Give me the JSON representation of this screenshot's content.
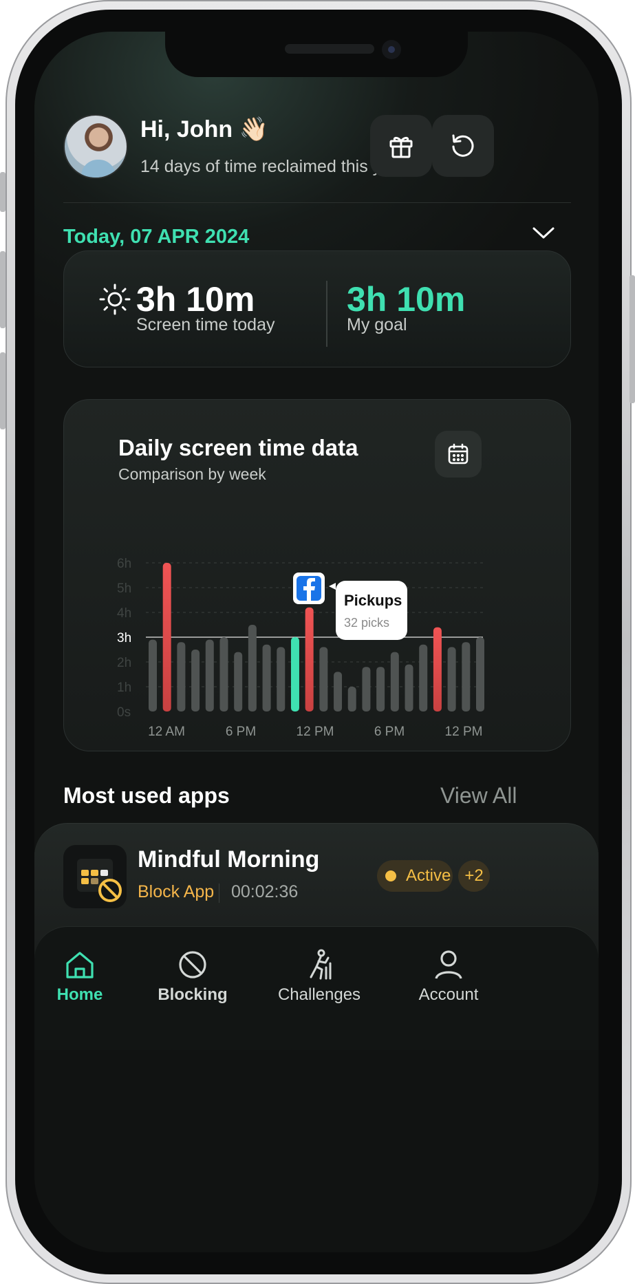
{
  "header": {
    "greeting": "Hi, John 👋🏻",
    "subtitle": "14 days of time reclaimed this year!"
  },
  "date_label": "Today, 07 APR 2024",
  "stats": {
    "screen_time_value": "3h 10m",
    "screen_time_label": "Screen time today",
    "goal_value": "3h 10m",
    "goal_label": "My goal"
  },
  "chart_card": {
    "title": "Daily screen time data",
    "subtitle": "Comparison by week"
  },
  "chart_data": {
    "type": "bar",
    "y_ticks": [
      "0s",
      "1h",
      "2h",
      "3h",
      "4h",
      "5h",
      "6h"
    ],
    "highlight_tick": "3h",
    "ylim": [
      0,
      6
    ],
    "x_tick_labels": [
      "12 AM",
      "6 PM",
      "12 PM",
      "6 PM",
      "12 PM"
    ],
    "values": [
      2.9,
      6.0,
      2.8,
      2.5,
      2.9,
      3.0,
      2.4,
      3.5,
      2.7,
      2.6,
      3.0,
      4.2,
      2.6,
      1.6,
      1.0,
      1.8,
      1.8,
      2.4,
      1.9,
      2.7,
      3.4,
      2.6,
      2.8,
      3.0
    ],
    "bar_colors": [
      "gray",
      "red",
      "gray",
      "gray",
      "gray",
      "gray",
      "gray",
      "gray",
      "gray",
      "gray",
      "teal",
      "red",
      "gray",
      "gray",
      "gray",
      "gray",
      "gray",
      "gray",
      "gray",
      "gray",
      "red",
      "gray",
      "gray",
      "gray"
    ],
    "colors": {
      "gray": "#4f5352",
      "red": "#ea4f4f",
      "teal": "#3fe0b1"
    },
    "tooltip": {
      "app_icon": "facebook-icon",
      "title": "Pickups",
      "detail": "32 picks"
    }
  },
  "most_used": {
    "title": "Most used apps",
    "view_all": "View All"
  },
  "app_row": {
    "name": "Mindful Morning",
    "type": "Block App",
    "timer": "00:02:36",
    "status": "Active",
    "more": "+2",
    "accent": "#f5bf45"
  },
  "nav": [
    {
      "label": "Home",
      "icon": "home-icon",
      "active": true
    },
    {
      "label": "Blocking",
      "icon": "block-icon",
      "active": false
    },
    {
      "label": "Challenges",
      "icon": "challenges-icon",
      "active": false
    },
    {
      "label": "Account",
      "icon": "account-icon",
      "active": false
    }
  ]
}
